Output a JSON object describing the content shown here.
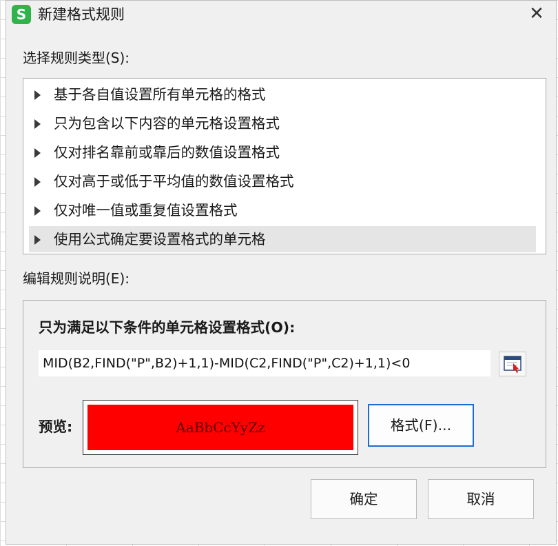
{
  "dialog": {
    "title": "新建格式规则",
    "app_logo": "S",
    "close_glyph": "✕"
  },
  "rule_type": {
    "label": "选择规则类型(S):",
    "items": [
      {
        "label": "基于各自值设置所有单元格的格式",
        "selected": false
      },
      {
        "label": "只为包含以下内容的单元格设置格式",
        "selected": false
      },
      {
        "label": "仅对排名靠前或靠后的数值设置格式",
        "selected": false
      },
      {
        "label": "仅对高于或低于平均值的数值设置格式",
        "selected": false
      },
      {
        "label": "仅对唯一值或重复值设置格式",
        "selected": false
      },
      {
        "label": "使用公式确定要设置格式的单元格",
        "selected": true
      }
    ]
  },
  "edit_rule": {
    "label": "编辑规则说明(E):",
    "formula_label": "只为满足以下条件的单元格设置格式(O):",
    "formula_value": "MID(B2,FIND(\"P\",B2)+1,1)-MID(C2,FIND(\"P\",C2)+1,1)<0",
    "ref_icon": "range-select-icon",
    "preview_label": "预览:",
    "preview_text": "AaBbCcYyZz",
    "preview_fill": "#ff0000",
    "preview_text_color": "#5a0000",
    "format_button": "格式(F)..."
  },
  "buttons": {
    "ok": "确定",
    "cancel": "取消"
  }
}
